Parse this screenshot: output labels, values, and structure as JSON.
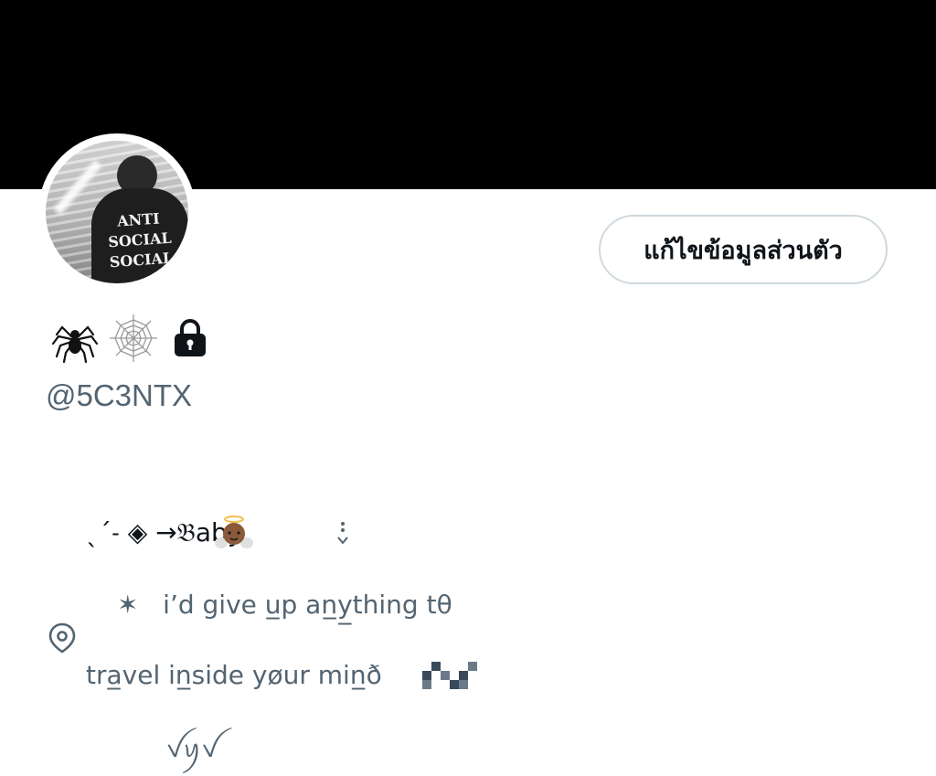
{
  "header": {
    "banner_color": "#000000"
  },
  "profile": {
    "avatar_jacket_text": "ANTI\nSOCIAL\nSOCIAL",
    "edit_button_label": "แก้ไขข้อมูลส่วนตัว",
    "name_icons": [
      "spider-icon",
      "spiderweb-icon",
      "lock-icon"
    ],
    "handle": "@5C3NTX"
  },
  "bio": {
    "line1": "ˎˊ˗ ◈ →𝔅aby",
    "line2": "✶   i’d give u̲p an̲y̲thing tθ",
    "line3": "tra̲vel in̲side yøur min̲ð",
    "line4": "ꪜꪗꪜ"
  },
  "location_icon": "map-pin-icon",
  "colors": {
    "text_primary": "#0f1419",
    "text_secondary": "#536471",
    "button_border": "#cfd9de"
  }
}
